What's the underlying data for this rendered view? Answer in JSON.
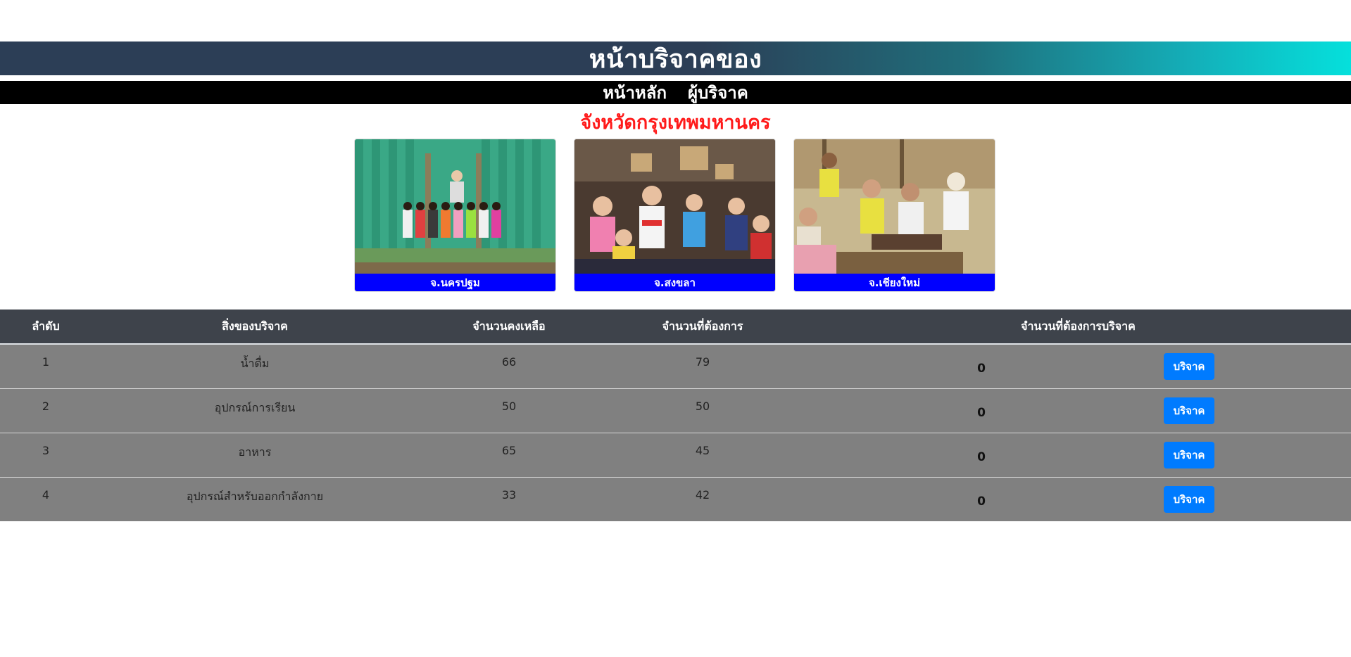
{
  "header": {
    "title": "หน้าบริจาคของ"
  },
  "nav": {
    "items": [
      {
        "label": "หน้าหลัก"
      },
      {
        "label": "ผู้บริจาค"
      }
    ]
  },
  "province": {
    "title": "จังหวัดกรุงเทพมหานคร"
  },
  "cards": [
    {
      "caption": "จ.นครปฐม"
    },
    {
      "caption": "จ.สงขลา"
    },
    {
      "caption": "จ.เชียงใหม่"
    }
  ],
  "table": {
    "headers": {
      "order": "ลำดับ",
      "item": "สิ่งของบริจาค",
      "remaining": "จำนวนคงเหลือ",
      "needed": "จำนวนที่ต้องการ",
      "donate_qty": "จำนวนที่ต้องการบริจาค"
    },
    "rows": [
      {
        "order": "1",
        "item": "น้ำดื่ม",
        "remaining": "66",
        "needed": "79",
        "donate_qty": "0",
        "button": "บริจาค"
      },
      {
        "order": "2",
        "item": "อุปกรณ์การเรียน",
        "remaining": "50",
        "needed": "50",
        "donate_qty": "0",
        "button": "บริจาค"
      },
      {
        "order": "3",
        "item": "อาหาร",
        "remaining": "65",
        "needed": "45",
        "donate_qty": "0",
        "button": "บริจาค"
      },
      {
        "order": "4",
        "item": "อุปกรณ์สำหรับออกกำลังกาย",
        "remaining": "33",
        "needed": "42",
        "donate_qty": "0",
        "button": "บริจาค"
      }
    ]
  },
  "colors": {
    "button": "#007bff",
    "caption_bg": "#0000ff",
    "province_title": "#ff1a1a"
  }
}
